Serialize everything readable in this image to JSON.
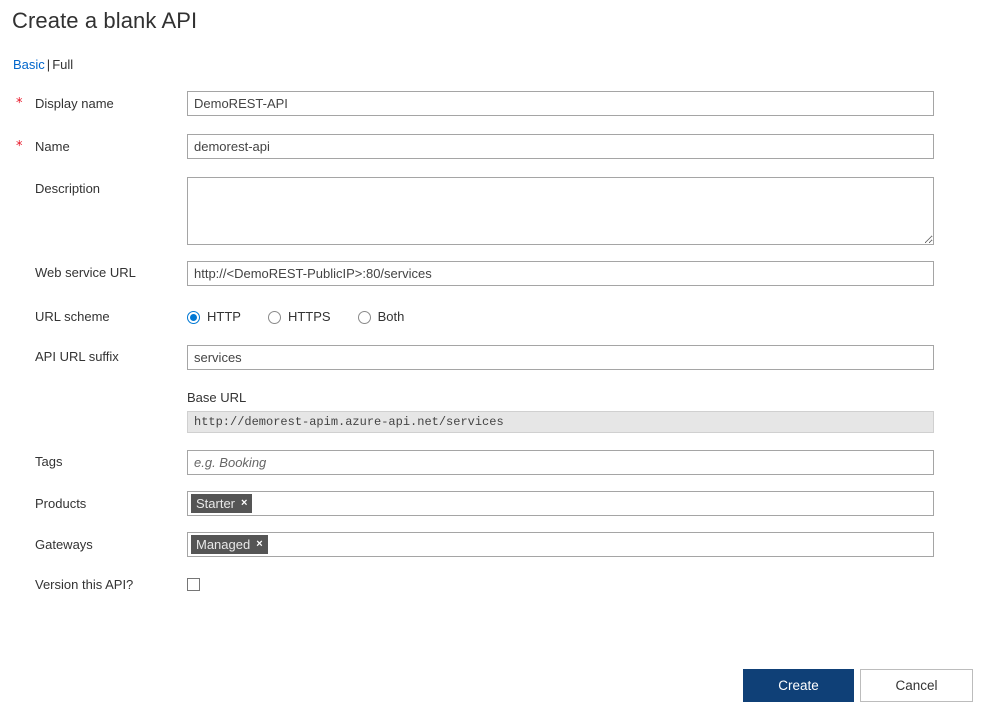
{
  "page": {
    "title": "Create a blank API"
  },
  "mode": {
    "basic_label": "Basic",
    "separator": "|",
    "full_label": "Full"
  },
  "required_marker": "*",
  "fields": {
    "display_name": {
      "label": "Display name",
      "value": "DemoREST-API"
    },
    "name": {
      "label": "Name",
      "value": "demorest-api"
    },
    "description": {
      "label": "Description",
      "value": ""
    },
    "web_service_url": {
      "label": "Web service URL",
      "value": "http://<DemoREST-PublicIP>:80/services"
    },
    "url_scheme": {
      "label": "URL scheme",
      "options": [
        {
          "label": "HTTP",
          "selected": true
        },
        {
          "label": "HTTPS",
          "selected": false
        },
        {
          "label": "Both",
          "selected": false
        }
      ]
    },
    "api_url_suffix": {
      "label": "API URL suffix",
      "value": "services"
    },
    "base_url": {
      "label": "Base URL",
      "value": "http://demorest-apim.azure-api.net/services"
    },
    "tags": {
      "label": "Tags",
      "value": "",
      "placeholder": "e.g. Booking"
    },
    "products": {
      "label": "Products",
      "chips": [
        {
          "label": "Starter",
          "remove": "×"
        }
      ]
    },
    "gateways": {
      "label": "Gateways",
      "chips": [
        {
          "label": "Managed",
          "remove": "×"
        }
      ]
    },
    "version_this_api": {
      "label": "Version this API?",
      "checked": false
    }
  },
  "actions": {
    "create_label": "Create",
    "cancel_label": "Cancel"
  },
  "colors": {
    "link_blue": "#0066cc",
    "required_red": "#e81123",
    "radio_accent": "#0078d4",
    "primary_button": "#0f4077",
    "chip_background": "#555555"
  }
}
